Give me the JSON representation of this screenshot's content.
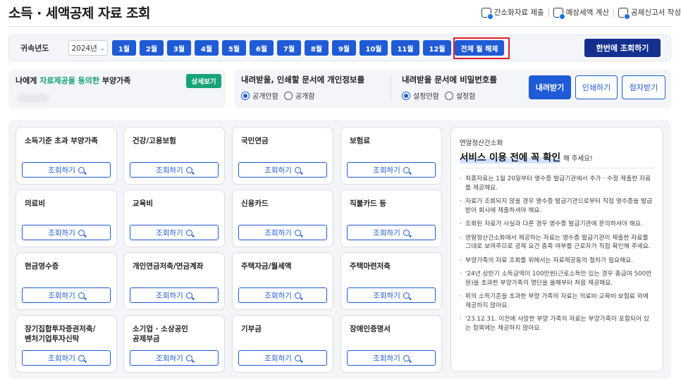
{
  "header": {
    "title": "소득 · 세액공제 자료 조회",
    "links": [
      {
        "label": "간소화자료 제출",
        "icon": "document-check-icon"
      },
      {
        "label": "예상세액 계산",
        "icon": "calculator-icon"
      },
      {
        "label": "공제신고서 작성",
        "icon": "edit-form-icon"
      }
    ]
  },
  "year_bar": {
    "label": "귀속년도",
    "year_value": "2024년",
    "months": [
      "1월",
      "2월",
      "3월",
      "4월",
      "5월",
      "6월",
      "7월",
      "8월",
      "9월",
      "10월",
      "11월",
      "12월"
    ],
    "clear_label": "전체 월 해제",
    "query_once_label": "한번에 조회하기"
  },
  "consent": {
    "prefix": "나에게",
    "highlight": "자료제공을 동의한",
    "suffix": "부양가족",
    "detail_label": "상세보기"
  },
  "options": {
    "privacy_title": "내려받을, 인쇄할 문서에 개인정보를",
    "privacy_options": [
      "공개안함",
      "공개함"
    ],
    "privacy_selected": 0,
    "password_title": "내려받을 문서에 비밀번호를",
    "password_options": [
      "설정안함",
      "설정함"
    ],
    "password_selected": 0,
    "download_label": "내려받기",
    "print_label": "인쇄하기",
    "braille_label": "점자받기"
  },
  "cards": [
    {
      "title": "소득기준 초과 부양가족"
    },
    {
      "title": "건강/고용보험"
    },
    {
      "title": "국민연금"
    },
    {
      "title": "보험료"
    },
    {
      "title": "의료비"
    },
    {
      "title": "교육비"
    },
    {
      "title": "신용카드"
    },
    {
      "title": "직불카드 등"
    },
    {
      "title": "현금영수증"
    },
    {
      "title": "개인연금저축/연금계좌"
    },
    {
      "title": "주택자금/월세액"
    },
    {
      "title": "주택마련저축"
    },
    {
      "title": "장기집합투자증권저축/\n벤처기업투자신탁"
    },
    {
      "title": "소기업 · 소상공인\n공제부금"
    },
    {
      "title": "기부금"
    },
    {
      "title": "장애인증명서"
    }
  ],
  "card_button_label": "조회하기",
  "notice": {
    "subtitle": "연말정산간소화",
    "headline": "서비스 이용 전에 꼭 확인",
    "headline_suffix": "해 주세요!",
    "items": [
      "최종자료는 1월 20일부터 영수증 발급기관에서 추가 · 수정 제출한 자료를 제공해요.",
      "자료가 조회되지 않을 경우 영수증 발급기관으로부터 직접 영수증을 발급받아 회사에 제출하셔야 해요.",
      "조회된 자료가 사실과 다른 경우 영수증 발급기관에 문의하셔야 해요.",
      "연말정산간소화에서 제공하는 자료는 영수증 발급기관이 제출한 자료를 그대로 보여주므로 공제 요건 충족 여부를 근로자가 직접 확인해 주세요.",
      "부양가족의 자료 조회를 위해서는 자료제공동의 절차가 필요해요.",
      "'24년 상반기 소득금액이 100만원(근로소득만 있는 경우 총급여 500만원)을 초과한 부양가족의 명단을 올해부터 처음 제공해요.",
      "위의 소득기준을 초과한 부양 가족의 자료는 의료비·교육비·보험료 외에 제공하지 않아요.",
      "'23.12.31. 이전에 사망한 부양 가족의 자료는 부양가족이 포함되어 있는 항목에는 제공하지 않아요."
    ]
  },
  "colors": {
    "primary": "#1f5bd6",
    "dark_button": "#14308f",
    "green": "#17a377",
    "highlight_border": "#e0202a"
  }
}
